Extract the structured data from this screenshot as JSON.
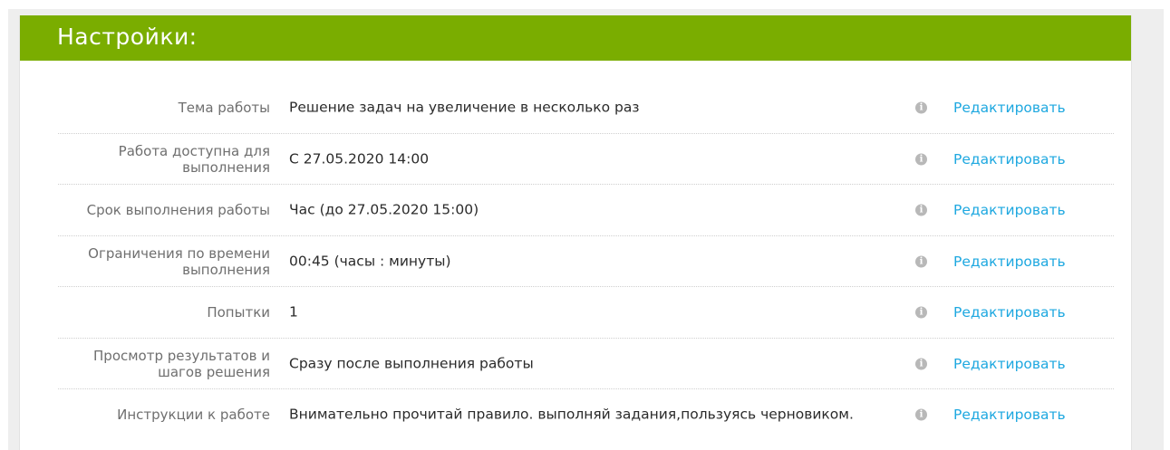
{
  "panel": {
    "title": "Настройки:"
  },
  "colors": {
    "header_bg": "#7aad00",
    "link": "#1ea8e0",
    "label": "#6f6f6f",
    "info_icon": "#b8b8b8"
  },
  "icons": {
    "info": "info-icon"
  },
  "settings": {
    "rows": [
      {
        "label": "Тема работы",
        "value": "Решение задач на увеличение в несколько раз",
        "info": "i",
        "action": "Редактировать"
      },
      {
        "label": "Работа доступна для выполнения",
        "value": "С 27.05.2020 14:00",
        "info": "i",
        "action": "Редактировать"
      },
      {
        "label": "Срок выполнения работы",
        "value": "Час (до 27.05.2020 15:00)",
        "info": "i",
        "action": "Редактировать"
      },
      {
        "label": "Ограничения по времени выполнения",
        "value": "00:45 (часы : минуты)",
        "info": "i",
        "action": "Редактировать"
      },
      {
        "label": "Попытки",
        "value": "1",
        "info": "i",
        "action": "Редактировать"
      },
      {
        "label": "Просмотр результатов и шагов решения",
        "value": "Сразу после выполнения работы",
        "info": "i",
        "action": "Редактировать"
      },
      {
        "label": "Инструкции к работе",
        "value": "Внимательно прочитай правило. выполняй задания,пользуясь черновиком.",
        "info": "i",
        "action": "Редактировать"
      }
    ]
  }
}
